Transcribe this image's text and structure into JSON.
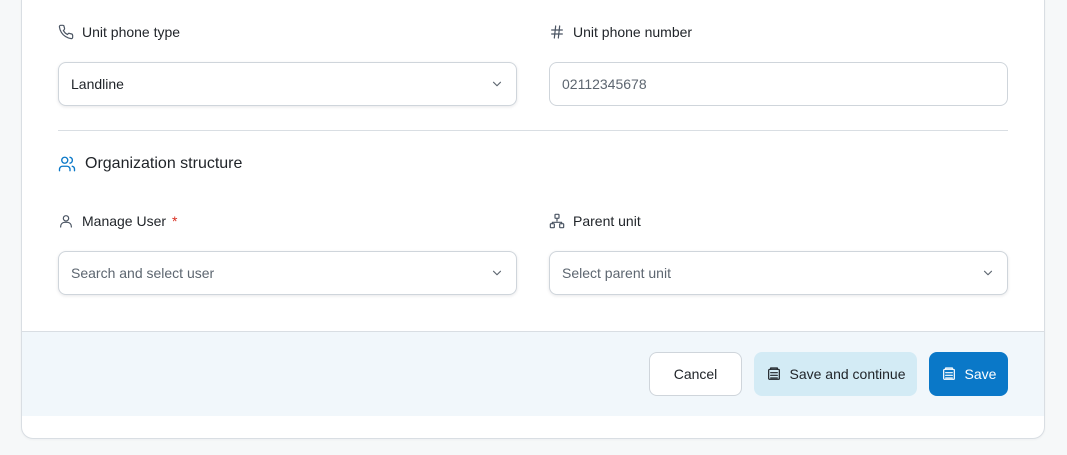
{
  "contact": {
    "phone_type": {
      "label": "Unit phone type",
      "icon": "phone-icon",
      "value": "Landline"
    },
    "phone_number": {
      "label": "Unit phone number",
      "icon": "hash-icon",
      "value": "02112345678"
    }
  },
  "organization": {
    "section_title": "Organization structure",
    "section_icon": "users-icon",
    "manage_user": {
      "label": "Manage User",
      "required_mark": "*",
      "icon": "user-icon",
      "placeholder": "Search and select user"
    },
    "parent_unit": {
      "label": "Parent unit",
      "icon": "hierarchy-icon",
      "placeholder": "Select parent unit"
    }
  },
  "footer": {
    "cancel_label": "Cancel",
    "save_continue_label": "Save and continue",
    "save_label": "Save"
  },
  "colors": {
    "accent": "#0a78c8",
    "secondary_button": "#d3ebf5",
    "required": "#d92d20",
    "footer_bg": "#f1f7fb"
  }
}
